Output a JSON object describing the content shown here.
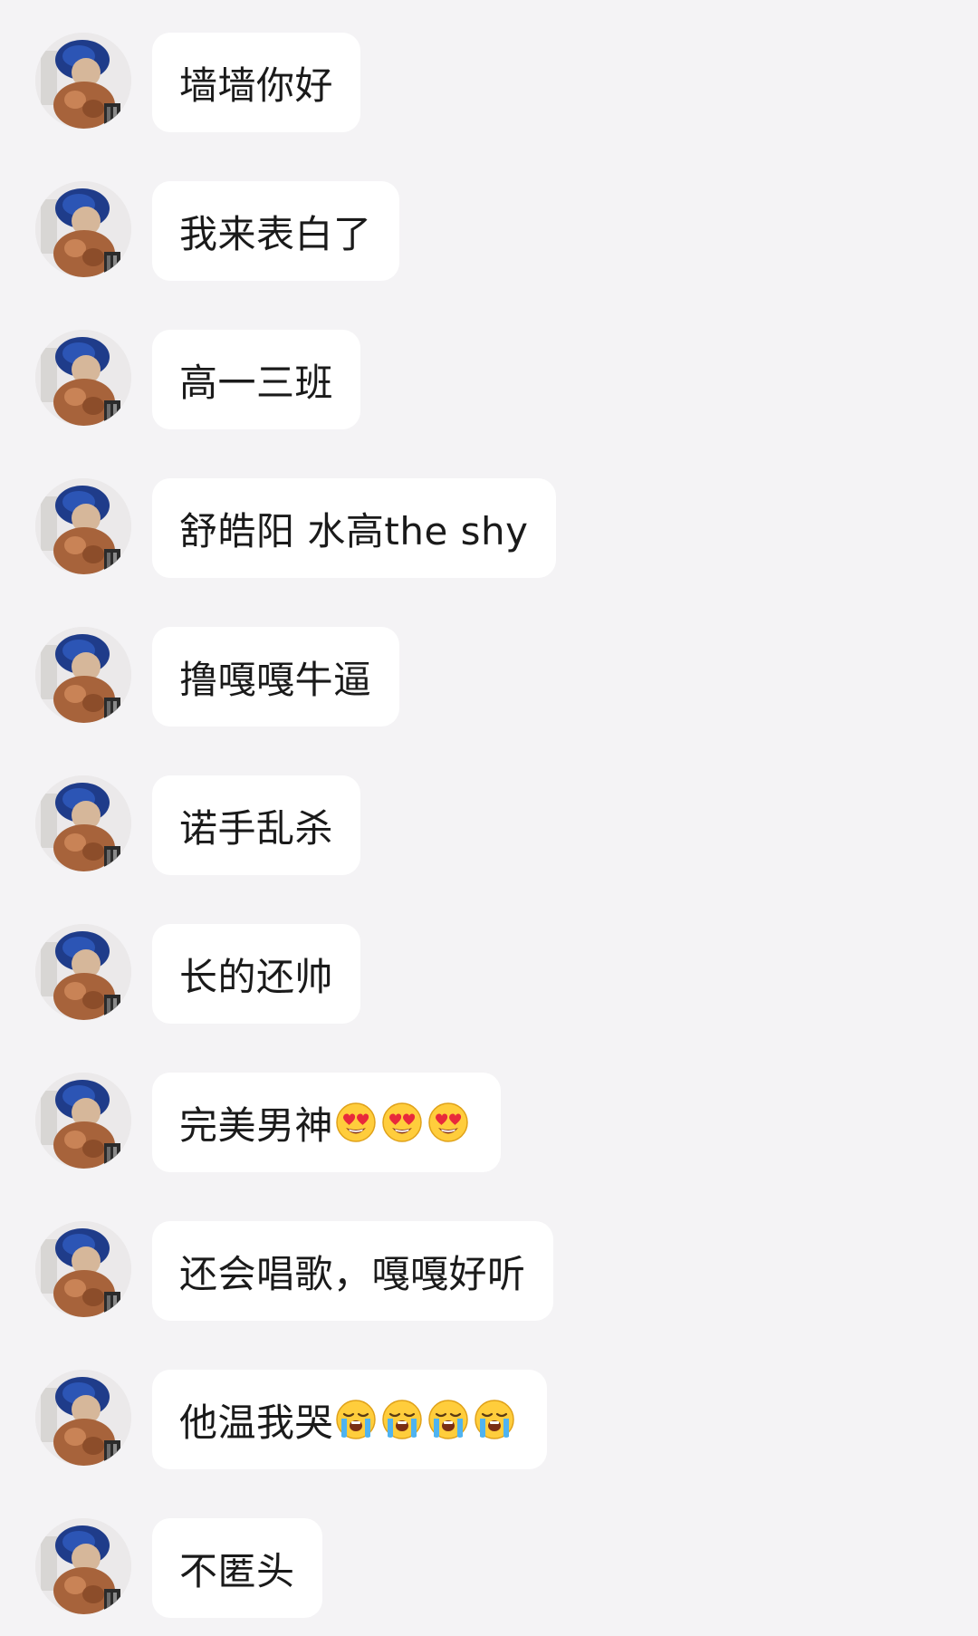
{
  "messages": [
    {
      "text": "墙墙你好",
      "emojis": []
    },
    {
      "text": "我来表白了",
      "emojis": []
    },
    {
      "text": "高一三班",
      "emojis": []
    },
    {
      "text": "舒皓阳 水高the shy",
      "emojis": []
    },
    {
      "text": "撸嘎嘎牛逼",
      "emojis": []
    },
    {
      "text": "诺手乱杀",
      "emojis": []
    },
    {
      "text": "长的还帅",
      "emojis": []
    },
    {
      "text": "完美男神",
      "emojis": [
        "heart-eyes-emoji",
        "heart-eyes-emoji",
        "heart-eyes-emoji"
      ]
    },
    {
      "text": "还会唱歌，嘎嘎好听",
      "emojis": []
    },
    {
      "text": "他温我哭",
      "emojis": [
        "loudly-crying-emoji",
        "loudly-crying-emoji",
        "loudly-crying-emoji",
        "loudly-crying-emoji"
      ]
    },
    {
      "text": "不匿头",
      "emojis": []
    }
  ],
  "colors": {
    "background": "#f4f3f5",
    "bubble": "#ffffff",
    "text": "#1a1a1a"
  }
}
